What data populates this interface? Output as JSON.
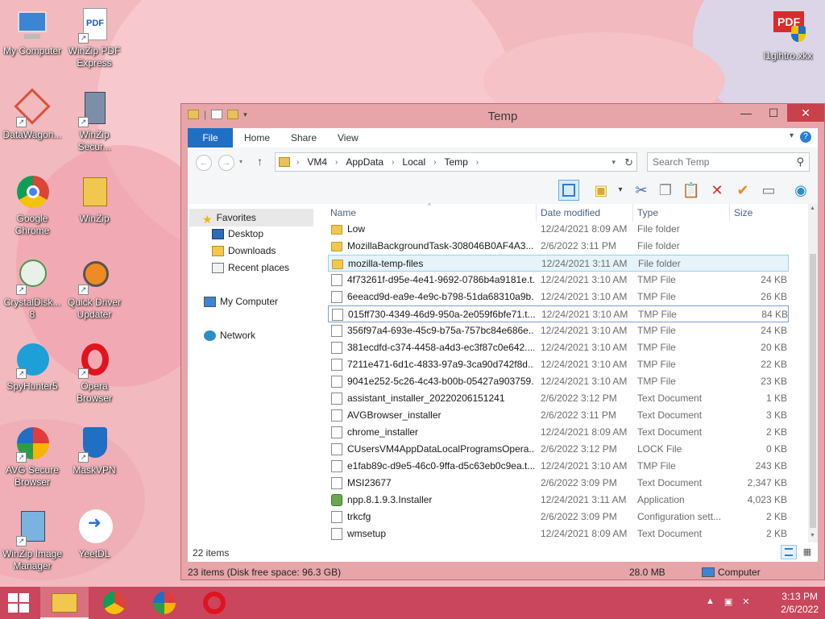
{
  "desktop": {
    "icons": [
      {
        "label": "My Computer"
      },
      {
        "label": "WinZip PDF Express"
      },
      {
        "label": "DataWagon..."
      },
      {
        "label": "WinZip Secur..."
      },
      {
        "label": "Google Chrome"
      },
      {
        "label": "WinZip"
      },
      {
        "label": "CrystalDisk... 8"
      },
      {
        "label": "Quick Driver Updater"
      },
      {
        "label": "SpyHunter5"
      },
      {
        "label": "Opera Browser"
      },
      {
        "label": "AVG Secure Browser"
      },
      {
        "label": "MaskVPN"
      },
      {
        "label": "WinZip Image Manager"
      },
      {
        "label": "YeetDL"
      },
      {
        "label": "l1gihtro.xkx"
      }
    ]
  },
  "window": {
    "title": "Temp",
    "controls": {
      "minimize": "—",
      "maximize": "☐",
      "close": "✕"
    },
    "ribbon": {
      "tabs": [
        "File",
        "Home",
        "Share",
        "View"
      ],
      "help": "?"
    },
    "address": {
      "crumbs": [
        "VM4",
        "AppData",
        "Local",
        "Temp"
      ]
    },
    "search": {
      "placeholder": "Search Temp"
    },
    "navpane": {
      "favorites": "Favorites",
      "fav_items": [
        "Desktop",
        "Downloads",
        "Recent places"
      ],
      "computer": "My Computer",
      "network": "Network"
    },
    "columns": {
      "name": "Name",
      "date": "Date modified",
      "type": "Type",
      "size": "Size"
    },
    "files": [
      {
        "icon": "folder",
        "name": "Low",
        "date": "12/24/2021 8:09 AM",
        "type": "File folder",
        "size": ""
      },
      {
        "icon": "folder",
        "name": "MozillaBackgroundTask-308046B0AF4A3...",
        "date": "2/6/2022 3:11 PM",
        "type": "File folder",
        "size": ""
      },
      {
        "icon": "folder",
        "name": "mozilla-temp-files",
        "date": "12/24/2021 3:11 AM",
        "type": "File folder",
        "size": ""
      },
      {
        "icon": "file",
        "name": "4f73261f-d95e-4e41-9692-0786b4a9181e.t...",
        "date": "12/24/2021 3:10 AM",
        "type": "TMP File",
        "size": "24 KB"
      },
      {
        "icon": "file",
        "name": "6eeacd9d-ea9e-4e9c-b798-51da68310a9b...",
        "date": "12/24/2021 3:10 AM",
        "type": "TMP File",
        "size": "26 KB"
      },
      {
        "icon": "file",
        "name": "015ff730-4349-46d9-950a-2e059f6bfe71.t...",
        "date": "12/24/2021 3:10 AM",
        "type": "TMP File",
        "size": "84 KB"
      },
      {
        "icon": "file",
        "name": "356f97a4-693e-45c9-b75a-757bc84e686e....",
        "date": "12/24/2021 3:10 AM",
        "type": "TMP File",
        "size": "24 KB"
      },
      {
        "icon": "file",
        "name": "381ecdfd-c374-4458-a4d3-ec3f87c0e642....",
        "date": "12/24/2021 3:10 AM",
        "type": "TMP File",
        "size": "20 KB"
      },
      {
        "icon": "file",
        "name": "7211e471-6d1c-4833-97a9-3ca90d742f8d....",
        "date": "12/24/2021 3:10 AM",
        "type": "TMP File",
        "size": "22 KB"
      },
      {
        "icon": "file",
        "name": "9041e252-5c26-4c43-b00b-05427a903759....",
        "date": "12/24/2021 3:10 AM",
        "type": "TMP File",
        "size": "23 KB"
      },
      {
        "icon": "file",
        "name": "assistant_installer_20220206151241",
        "date": "2/6/2022 3:12 PM",
        "type": "Text Document",
        "size": "1 KB"
      },
      {
        "icon": "file",
        "name": "AVGBrowser_installer",
        "date": "2/6/2022 3:11 PM",
        "type": "Text Document",
        "size": "3 KB"
      },
      {
        "icon": "file",
        "name": "chrome_installer",
        "date": "12/24/2021 8:09 AM",
        "type": "Text Document",
        "size": "2 KB"
      },
      {
        "icon": "file",
        "name": "CUsersVM4AppDataLocalProgramsOpera...",
        "date": "2/6/2022 3:12 PM",
        "type": "LOCK File",
        "size": "0 KB"
      },
      {
        "icon": "file",
        "name": "e1fab89c-d9e5-46c0-9ffa-d5c63eb0c9ea.t...",
        "date": "12/24/2021 3:10 AM",
        "type": "TMP File",
        "size": "243 KB"
      },
      {
        "icon": "file",
        "name": "MSI23677",
        "date": "2/6/2022 3:09 PM",
        "type": "Text Document",
        "size": "2,347 KB"
      },
      {
        "icon": "app",
        "name": "npp.8.1.9.3.Installer",
        "date": "12/24/2021 3:11 AM",
        "type": "Application",
        "size": "4,023 KB"
      },
      {
        "icon": "cfg",
        "name": "trkcfg",
        "date": "2/6/2022 3:09 PM",
        "type": "Configuration sett...",
        "size": "2 KB"
      },
      {
        "icon": "file",
        "name": "wmsetup",
        "date": "12/24/2021 8:09 AM",
        "type": "Text Document",
        "size": "2 KB"
      }
    ],
    "status_count": "22 items",
    "details": {
      "items": "23 items (Disk free space: 96.3 GB)",
      "size": "28.0 MB",
      "location": "Computer"
    }
  },
  "taskbar": {
    "time": "3:13 PM",
    "date": "2/6/2022"
  },
  "colors": {
    "accent": "#1f6fc5",
    "taskbar": "#c9465d",
    "window_frame": "#e7a5a9",
    "selection": "#e5f3fb"
  }
}
